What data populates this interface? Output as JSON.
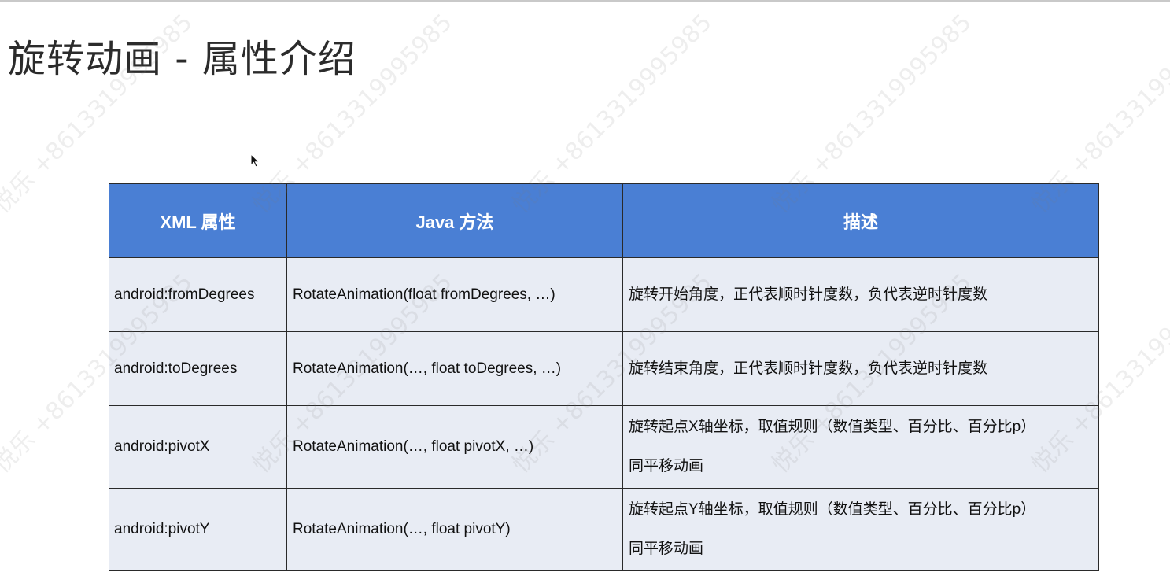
{
  "slide": {
    "title": "旋转动画 - 属性介绍",
    "watermark": "悦乐 +8613319995985"
  },
  "table": {
    "headers": [
      "XML 属性",
      "Java 方法",
      "描述"
    ],
    "rows": [
      {
        "xml": "android:fromDegrees",
        "java": "RotateAnimation(float fromDegrees, …)",
        "desc_line1": "旋转开始角度，正代表顺时针度数，负代表逆时针度数",
        "desc_line2": ""
      },
      {
        "xml": "android:toDegrees",
        "java": "RotateAnimation(…, float toDegrees, …)",
        "desc_line1": "旋转结束角度，正代表顺时针度数，负代表逆时针度数",
        "desc_line2": ""
      },
      {
        "xml": "android:pivotX",
        "java": "RotateAnimation(…, float pivotX, …)",
        "desc_line1": "旋转起点X轴坐标，取值规则（数值类型、百分比、百分比p）",
        "desc_line2": "同平移动画"
      },
      {
        "xml": "android:pivotY",
        "java": "RotateAnimation(…, float pivotY)",
        "desc_line1": "旋转起点Y轴坐标，取值规则（数值类型、百分比、百分比p）",
        "desc_line2": "同平移动画"
      }
    ]
  },
  "colors": {
    "header_bg": "#4a7fd4",
    "cell_bg": "#e8ecf4"
  }
}
